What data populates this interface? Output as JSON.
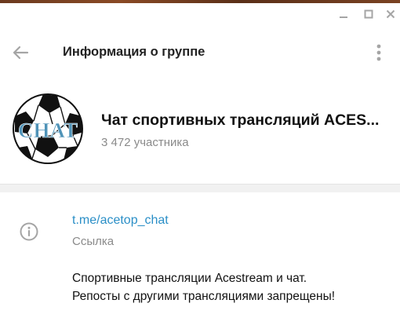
{
  "window": {
    "controls": {
      "minimize_icon": "minimize-icon",
      "maximize_icon": "maximize-icon",
      "close_icon": "close-icon"
    }
  },
  "header": {
    "title": "Информация о группе",
    "back_icon": "arrow-left-icon",
    "more_icon": "more-vertical-icon"
  },
  "group": {
    "name": "Чат спортивных трансляций ACES...",
    "members": "3 472 участника",
    "avatar_text": "CHAT"
  },
  "info": {
    "icon": "info-icon",
    "link": "t.me/acetop_chat",
    "link_label": "Ссылка",
    "description_lines": [
      "Спортивные трансляции Acestream и чат.",
      "Репосты с другими трансляциями запрещены!"
    ]
  },
  "colors": {
    "accent_link": "#2b8fc7",
    "secondary_text": "#8a8a8a",
    "icon_gray": "#a5a5a5",
    "avatar_text": "#4f93b8"
  }
}
